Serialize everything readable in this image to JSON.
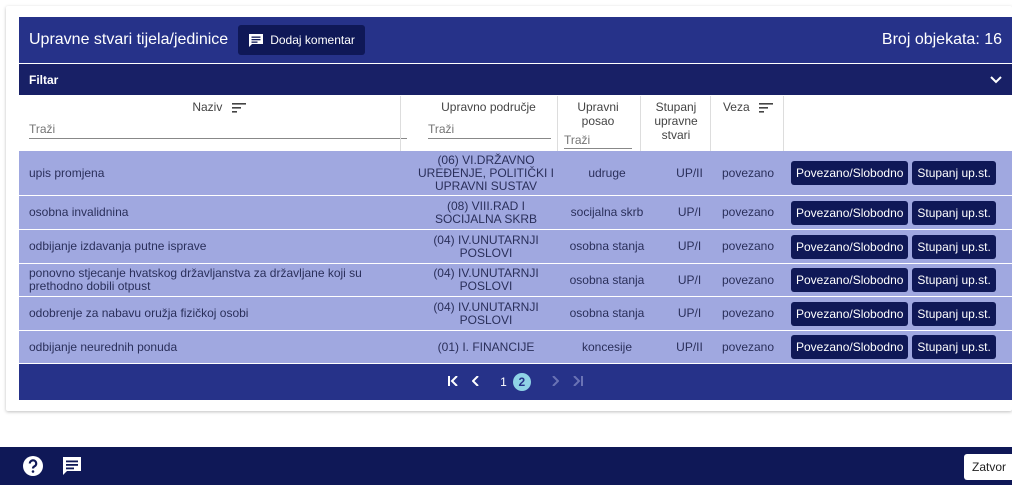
{
  "header": {
    "title": "Upravne stvari tijela/jedinice",
    "comment_button": "Dodaj komentar",
    "object_count": "Broj objekata: 16"
  },
  "filter": {
    "label": "Filtar"
  },
  "columns": {
    "naziv": "Naziv",
    "podrucje": "Upravno područje",
    "posao": "Upravni posao",
    "stupanj": "Stupanj upravne stvari",
    "veza": "Veza",
    "search_placeholder": "Traži"
  },
  "rows": [
    {
      "naziv": "upis promjena",
      "podrucje": "(06) VI.DRŽAVNO UREĐENJE, POLITIČKI I UPRAVNI SUSTAV",
      "posao": "udruge",
      "stupanj": "UP/II",
      "veza": "povezano",
      "btn1": "Povezano/Slobodno",
      "btn2": "Stupanj up.st."
    },
    {
      "naziv": "osobna invalidnina",
      "podrucje": "(08) VIII.RAD I SOCIJALNA SKRB",
      "posao": "socijalna skrb",
      "stupanj": "UP/I",
      "veza": "povezano",
      "btn1": "Povezano/Slobodno",
      "btn2": "Stupanj up.st."
    },
    {
      "naziv": "odbijanje izdavanja putne isprave",
      "podrucje": "(04) IV.UNUTARNJI POSLOVI",
      "posao": "osobna stanja",
      "stupanj": "UP/I",
      "veza": "povezano",
      "btn1": "Povezano/Slobodno",
      "btn2": "Stupanj up.st."
    },
    {
      "naziv": "ponovno stjecanje hvatskog državljanstva za državljane koji su prethodno dobili otpust",
      "podrucje": "(04) IV.UNUTARNJI POSLOVI",
      "posao": "osobna stanja",
      "stupanj": "UP/I",
      "veza": "povezano",
      "btn1": "Povezano/Slobodno",
      "btn2": "Stupanj up.st."
    },
    {
      "naziv": "odobrenje za nabavu oružja fizičkoj osobi",
      "podrucje": "(04) IV.UNUTARNJI POSLOVI",
      "posao": "osobna stanja",
      "stupanj": "UP/I",
      "veza": "povezano",
      "btn1": "Povezano/Slobodno",
      "btn2": "Stupanj up.st."
    },
    {
      "naziv": "odbijanje neurednih ponuda",
      "podrucje": "(01) I. FINANCIJE",
      "posao": "koncesije",
      "stupanj": "UP/II",
      "veza": "povezano",
      "btn1": "Povezano/Slobodno",
      "btn2": "Stupanj up.st."
    }
  ],
  "pager": {
    "pages": [
      "1",
      "2"
    ],
    "current": "2"
  },
  "footer": {
    "close_label": "Zatvor"
  },
  "icons": {
    "help": "help-icon",
    "comment": "comment-icon",
    "chevron": "chevron-down-icon",
    "sort": "sort-icon"
  },
  "colors": {
    "primary": "#263289",
    "dark": "#0f1857",
    "row": "#a0a8e0",
    "active_page": "#8fd3e6"
  }
}
